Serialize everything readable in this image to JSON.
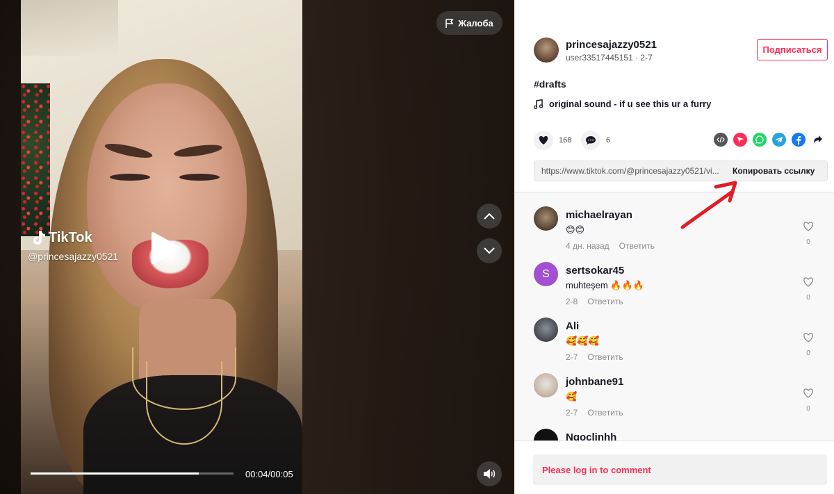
{
  "video": {
    "report_label": "Жалоба",
    "watermark_brand": "TikTok",
    "watermark_handle": "@princesajazzy0521",
    "time_label": "00:04/00:05",
    "progress_fraction": 0.83
  },
  "author": {
    "username": "princesajazzy0521",
    "subline": "user33517445151 · 2-7",
    "follow_label": "Подписаться"
  },
  "post": {
    "hashtag": "#drafts",
    "sound": "original sound - if u see this ur a furry"
  },
  "stats": {
    "likes": "168",
    "comments": "6"
  },
  "share": {
    "icons": [
      "embed-icon",
      "telegram-red-icon",
      "whatsapp-icon",
      "telegram-icon",
      "facebook-icon",
      "share-arrow-icon"
    ]
  },
  "link": {
    "url": "https://www.tiktok.com/@princesajazzy0521/vi...",
    "copy_label": "Копировать ссылку"
  },
  "comments": [
    {
      "name": "michaelrayan",
      "text": "😊😊",
      "date": "4 дн. назад",
      "reply": "Ответить",
      "likes": "0"
    },
    {
      "name": "sertsokar45",
      "text": "muhteşem 🔥🔥🔥",
      "date": "2-8",
      "reply": "Ответить",
      "likes": "0",
      "initial": "S"
    },
    {
      "name": "Ali",
      "text": "🥰🥰🥰",
      "date": "2-7",
      "reply": "Ответить",
      "likes": "0"
    },
    {
      "name": "johnbane91",
      "text": "🥰",
      "date": "2-7",
      "reply": "Ответить",
      "likes": "0"
    },
    {
      "name": "Ngoclinhh"
    }
  ],
  "login": {
    "label": "Please log in to comment"
  },
  "colors": {
    "accent": "#fe2c55",
    "annotation_arrow": "#e01e26"
  }
}
